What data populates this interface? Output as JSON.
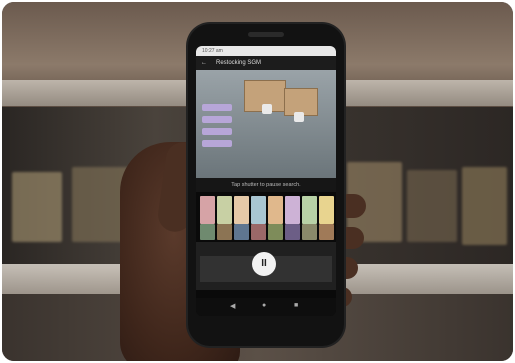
{
  "phone": {
    "status_time": "10:27 am",
    "app_title": "Restocking SGM",
    "back_icon": "arrow-back-icon",
    "hint_text": "Tap shutter to pause search.",
    "shutter_icon": "pause-icon",
    "nav_icons": [
      "back-triangle-icon",
      "home-circle-icon",
      "recents-square-icon"
    ],
    "nav_glyphs": [
      "◀",
      "●",
      "■"
    ]
  },
  "colors": {
    "tag_purple": "#b7a6d8",
    "background_shelf": "#4a433c"
  }
}
